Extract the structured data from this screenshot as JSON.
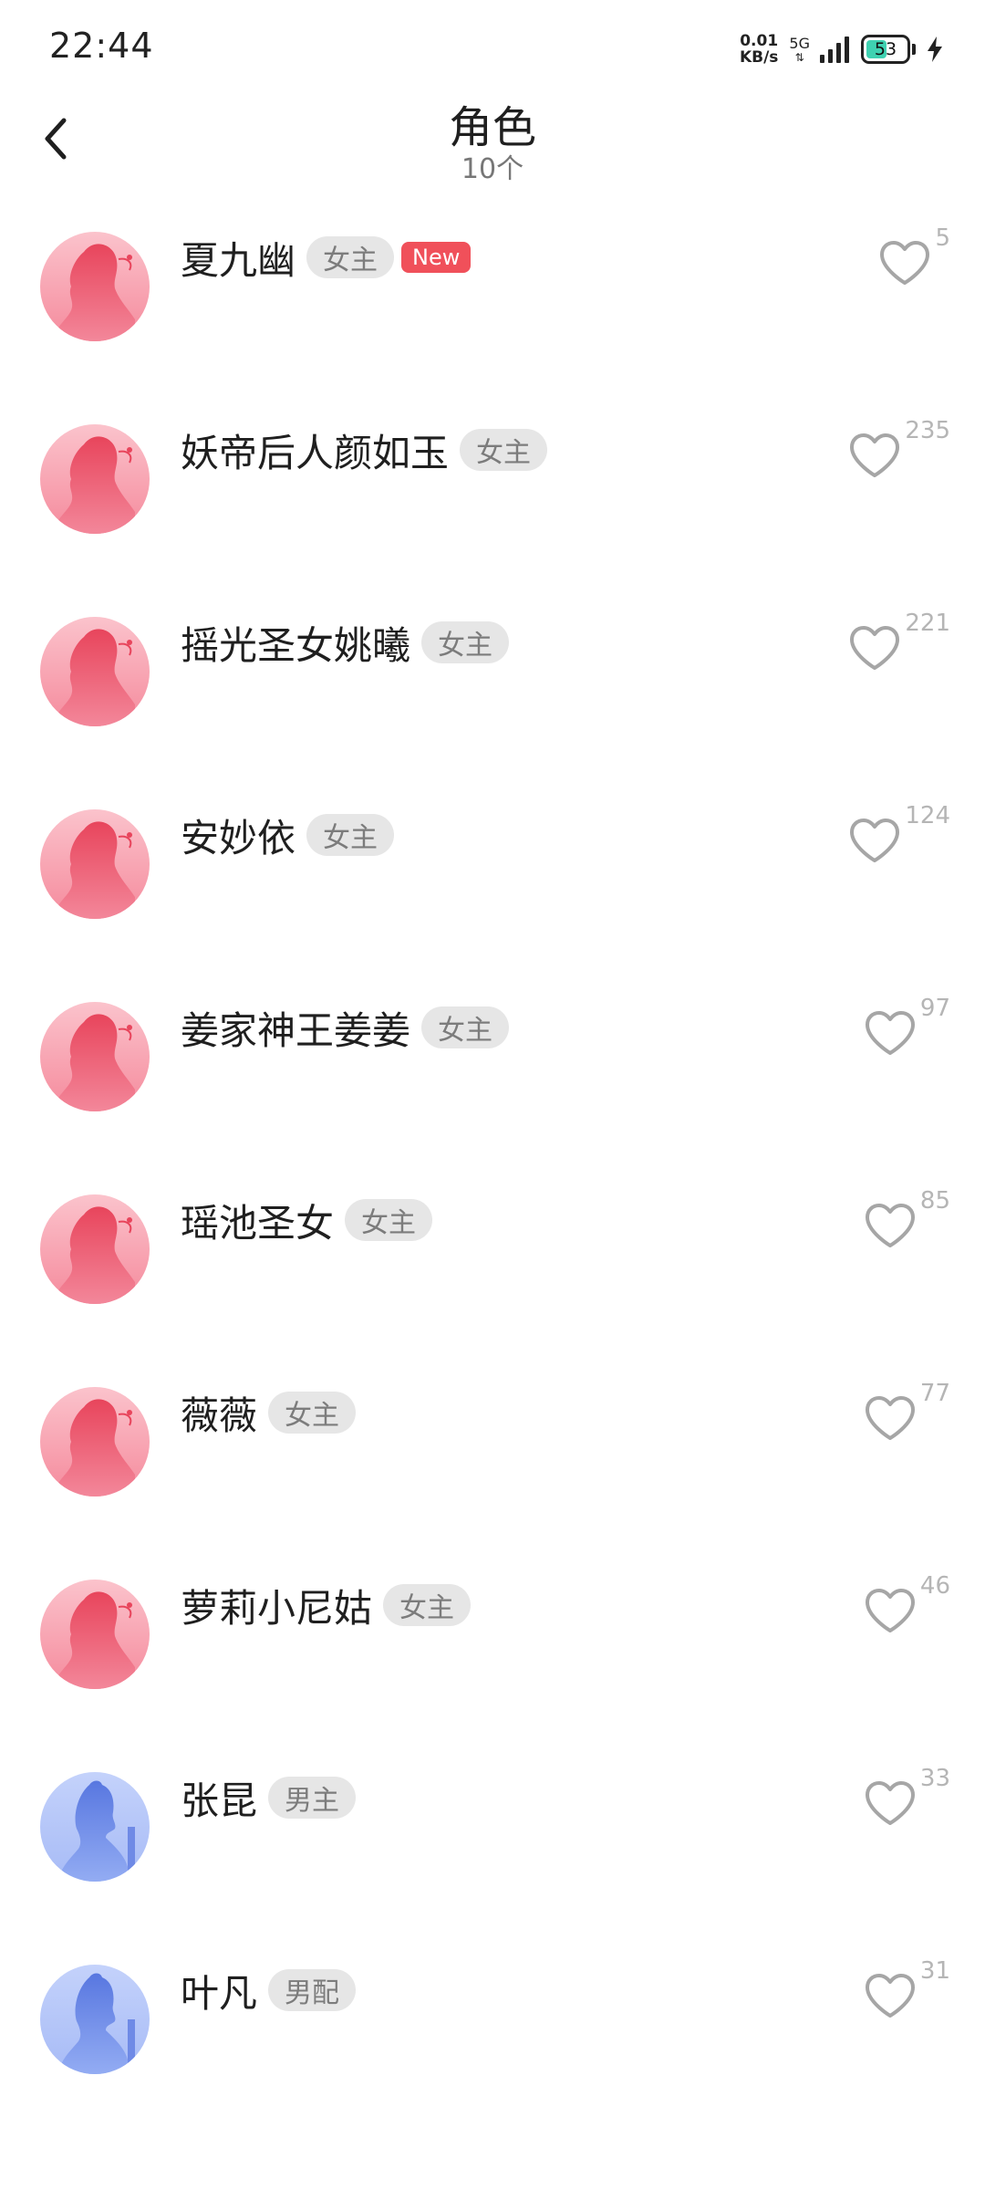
{
  "status_bar": {
    "time": "22:44",
    "net_speed_value": "0.01",
    "net_speed_unit": "KB/s",
    "network_type": "5G",
    "battery_level": "53",
    "battery_fraction": 0.53
  },
  "header": {
    "title": "角色",
    "subtitle": "10个"
  },
  "colors": {
    "female_avatar": "#f5a3b0",
    "male_avatar": "#8aa4f0",
    "tag_bg": "#e6e6e6",
    "new_badge": "#f0505a"
  },
  "characters": [
    {
      "name": "夏九幽",
      "tag": "女主",
      "new": "New",
      "likes": "5",
      "gender": "female"
    },
    {
      "name": "妖帝后人颜如玉",
      "tag": "女主",
      "likes": "235",
      "gender": "female"
    },
    {
      "name": "摇光圣女姚曦",
      "tag": "女主",
      "likes": "221",
      "gender": "female"
    },
    {
      "name": "安妙依",
      "tag": "女主",
      "likes": "124",
      "gender": "female"
    },
    {
      "name": "姜家神王姜姜",
      "tag": "女主",
      "likes": "97",
      "gender": "female"
    },
    {
      "name": "瑶池圣女",
      "tag": "女主",
      "likes": "85",
      "gender": "female"
    },
    {
      "name": "薇薇",
      "tag": "女主",
      "likes": "77",
      "gender": "female"
    },
    {
      "name": "萝莉小尼姑",
      "tag": "女主",
      "likes": "46",
      "gender": "female"
    },
    {
      "name": "张昆",
      "tag": "男主",
      "likes": "33",
      "gender": "male"
    },
    {
      "name": "叶凡",
      "tag": "男配",
      "likes": "31",
      "gender": "male"
    }
  ]
}
